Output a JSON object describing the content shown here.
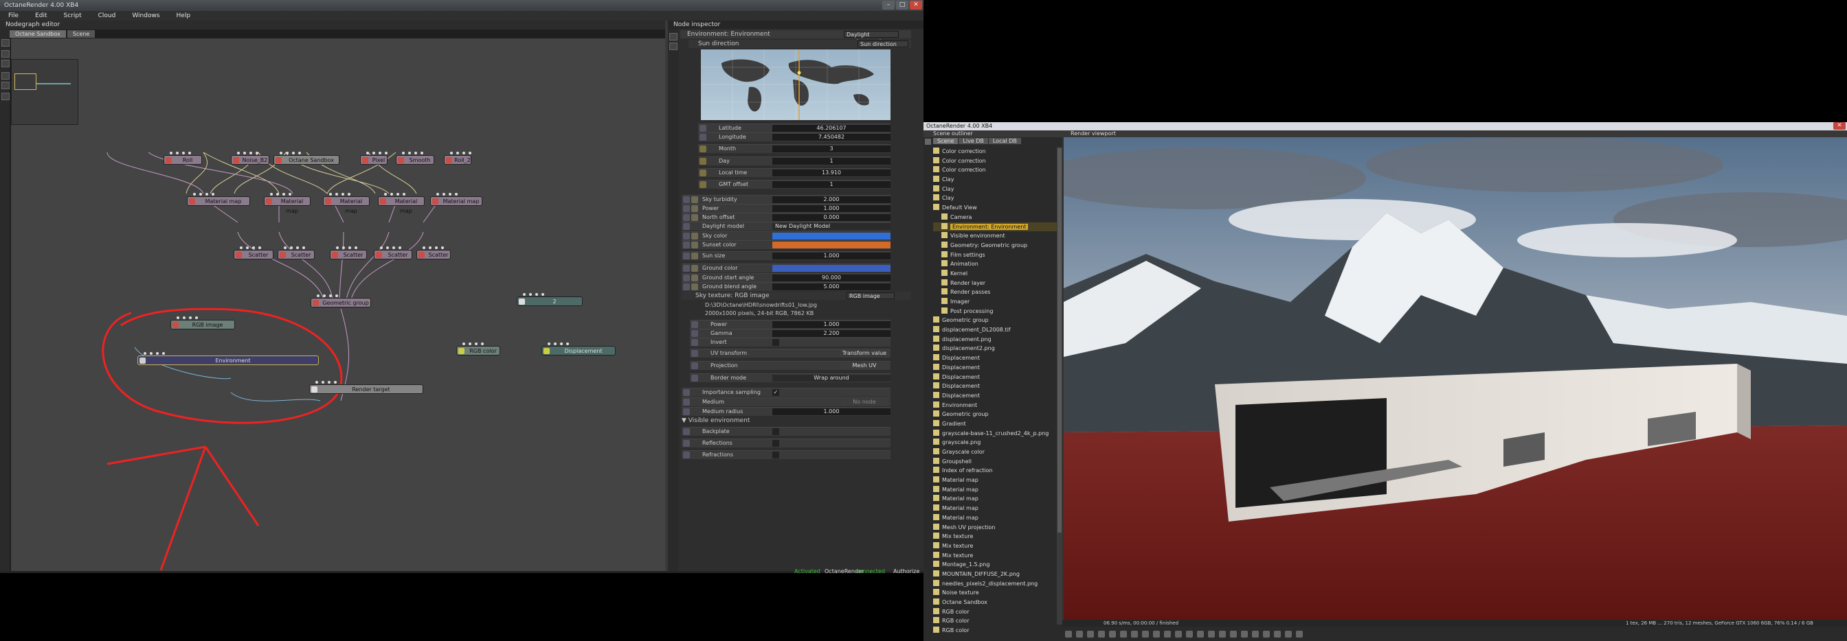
{
  "left_window": {
    "title": "OctaneRender 4.00 XB4",
    "menu": [
      "File",
      "Edit",
      "Script",
      "Cloud",
      "Windows",
      "Help"
    ],
    "graph_editor": {
      "title": "Nodegraph editor",
      "tabs": [
        "Octane Sandbox",
        "Scene"
      ],
      "nodes": {
        "n1": "Roll",
        "n2": "Noise_B2",
        "n3": "Octane Sandbox",
        "n4": "Pixel",
        "n5": "Smooth",
        "n6": "Roll_2",
        "m1": "Material map",
        "m2": "Material map",
        "m3": "Material map",
        "m4": "Material map",
        "m5": "Material map",
        "s1": "Scatter",
        "s2": "Scatter",
        "s3": "Scatter",
        "s4": "Scatter",
        "s5": "Scatter",
        "geo": "Geometric group",
        "rgb": "RGB image",
        "env": "Environment",
        "render": "Render target",
        "box": "2",
        "rgbc": "RGB color",
        "disp": "Displacement"
      }
    },
    "inspector": {
      "title": "Node inspector",
      "header": "Environment: Environment",
      "header_dropdown": "Daylight environment",
      "sun_direction": "Sun direction",
      "sun_direction_dropdown": "Sun direction",
      "params": [
        {
          "label": "Latitude",
          "value": "46.206107"
        },
        {
          "label": "Longitude",
          "value": "7.450482"
        },
        {
          "label": "Month",
          "value": "3"
        },
        {
          "label": "Day",
          "value": "1"
        },
        {
          "label": "Local time",
          "value": "13.910"
        },
        {
          "label": "GMT offset",
          "value": "1"
        }
      ],
      "params2": [
        {
          "label": "Sky turbidity",
          "value": "2.000"
        },
        {
          "label": "Power",
          "value": "1.000"
        },
        {
          "label": "North offset",
          "value": "0.000"
        },
        {
          "label": "Daylight model",
          "value": "New Daylight Model"
        },
        {
          "label": "Sky color",
          "value": ""
        },
        {
          "label": "Sunset color",
          "value": ""
        },
        {
          "label": "Sun size",
          "value": "1.000"
        },
        {
          "label": "Ground color",
          "value": ""
        },
        {
          "label": "Ground start angle",
          "value": "90.000"
        },
        {
          "label": "Ground blend angle",
          "value": "5.000"
        }
      ],
      "sky_texture": "Sky texture: RGB image",
      "sky_texture_dropdown": "RGB image",
      "file_path": "D:\\3D\\Octane\\HDRI\\snowdrifts01_low.jpg",
      "file_info": "2000x1000 pixels, 24-bit RGB, 7862 KB",
      "params3": [
        {
          "label": "Power",
          "value": "1.000"
        },
        {
          "label": "Gamma",
          "value": "2.200"
        },
        {
          "label": "Invert",
          "value": ""
        },
        {
          "label": "UV transform",
          "value": "Transform value"
        },
        {
          "label": "Projection",
          "value": "Mesh UV"
        },
        {
          "label": "Border mode",
          "value": "Wrap around"
        }
      ],
      "params4": [
        {
          "label": "Importance sampling",
          "value": "✓"
        },
        {
          "label": "Medium",
          "value": "No node"
        },
        {
          "label": "Medium radius",
          "value": "1.000"
        }
      ],
      "visible_env": "Visible environment",
      "params5": [
        {
          "label": "Backplate",
          "value": ""
        },
        {
          "label": "Reflections",
          "value": ""
        },
        {
          "label": "Refractions",
          "value": ""
        }
      ]
    },
    "status": {
      "a": "Activated",
      "b": "OctaneRender",
      "c": "connected",
      "d": "Authorize"
    }
  },
  "right_window": {
    "title": "OctaneRender 4.00 XB4",
    "outliner_title": "Scene outliner",
    "outliner_tabs": [
      "Scene",
      "Live DB",
      "Local DB"
    ],
    "outliner_items": [
      "Color correction",
      "Color correction",
      "Color correction",
      "Clay",
      "Clay",
      "Clay",
      "Default View",
      "Camera",
      "Environment: Environment",
      "Visible environment",
      "Geometry: Geometric group",
      "Film settings",
      "Animation",
      "Kernel",
      "Render layer",
      "Render passes",
      "Imager",
      "Post processing",
      "Geometric group",
      "displacement_DL2008.tif",
      "displacement.png",
      "displacement2.png",
      "Displacement",
      "Displacement",
      "Displacement",
      "Displacement",
      "Displacement",
      "Environment",
      "Geometric group",
      "Gradient",
      "grayscale-base-11_crushed2_4k_p.png",
      "grayscale.png",
      "Grayscale color",
      "Groupshell",
      "Index of refraction",
      "Material map",
      "Material map",
      "Material map",
      "Material map",
      "Material map",
      "Mesh UV projection",
      "Mix texture",
      "Mix texture",
      "Mix texture",
      "Montage_1.5.png",
      "MOUNTAIN_DIFFUSE_2K.png",
      "needles_pixels2_displacement.png",
      "Noise texture",
      "Octane Sandbox",
      "RGB color",
      "RGB color",
      "RGB color"
    ],
    "viewport_title": "Render viewport",
    "viewport_status_left": "06.90 s/ms, 00:00:00 / finished",
    "viewport_status_right": "1 tex, 26 MB ... 270 tris, 12 meshes, GeForce GTX 1060 6GB, 76% 0.14 / 6 GB"
  }
}
